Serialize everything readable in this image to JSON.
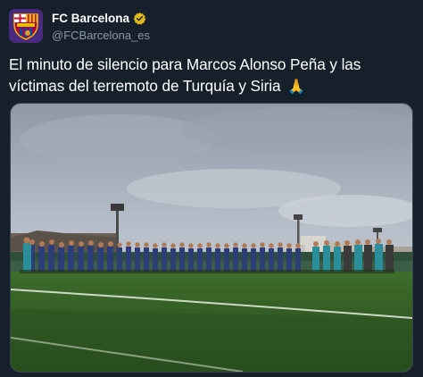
{
  "account": {
    "display_name": "FC Barcelona",
    "handle": "@FCBarcelona_es",
    "verified_icon": "verified-badge-icon",
    "avatar_icon": "fcb-crest-icon"
  },
  "tweet": {
    "text": "El minuto de silencio para Marcos Alonso Peña y las víctimas del terremoto de Turquía y Siria",
    "emoji": "🙏"
  },
  "media": {
    "type": "photo",
    "description_icon": "photo-icon"
  },
  "colors": {
    "background": "#15202b",
    "text": "#ffffff",
    "secondary_text": "#8b98a5",
    "verified": "#e2b719",
    "avatar_bg": "#4a2a7e"
  }
}
